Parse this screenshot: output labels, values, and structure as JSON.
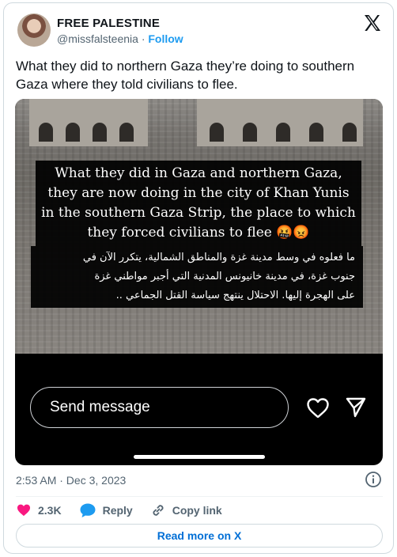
{
  "author": {
    "display_name": "FREE PALESTINE",
    "handle": "@missfalsteenia",
    "separator": "·",
    "follow_label": "Follow"
  },
  "tweet": {
    "text": "What they did to northern Gaza they’re doing to southern Gaza where they told civilians to flee."
  },
  "media": {
    "caption_en": [
      "What they did in Gaza and northern Gaza,",
      "they are now doing in the city of Khan Yunis",
      "in the southern Gaza Strip, the place to which",
      "they forced civilians to flee 🤬😡"
    ],
    "caption_ar": [
      "ما فعلوه في وسط مدينة غزة والمناطق الشمالية، يتكرر الآن في",
      "جنوب غزة، في مدينة خانيونس المدنية التي أجبر مواطني غزة",
      "على الهجرة إليها. الاحتلال ينتهج سياسة القتل الجماعي .."
    ],
    "send_placeholder": "Send message"
  },
  "meta": {
    "timestamp": "2:53 AM · Dec 3, 2023"
  },
  "actions": {
    "like_count": "2.3K",
    "reply_label": "Reply",
    "copy_label": "Copy link",
    "read_more_label": "Read more on X"
  },
  "colors": {
    "accent": "#1d9bf0",
    "like": "#f91880",
    "link": "#006fd6"
  },
  "icons": [
    "x-logo-icon",
    "heart-icon",
    "send-icon",
    "info-icon",
    "speech-bubble-icon",
    "link-icon"
  ]
}
